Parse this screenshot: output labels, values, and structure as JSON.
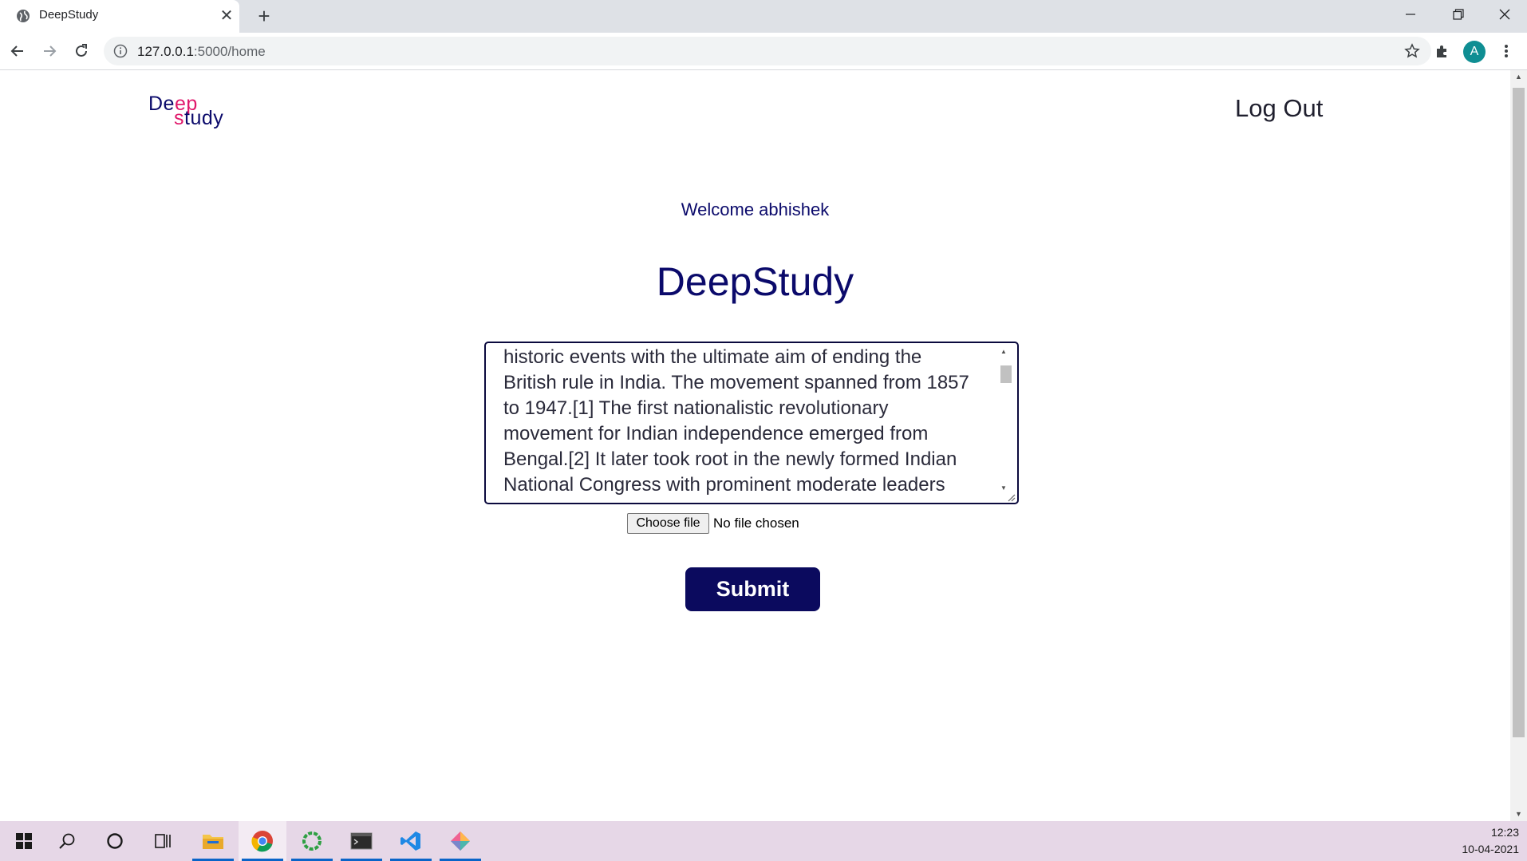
{
  "browser": {
    "tab_title": "DeepStudy",
    "url_host": "127.0.0.1",
    "url_path": ":5000/home",
    "profile_initial": "A"
  },
  "page": {
    "logo_line1_a": "De",
    "logo_line1_b": "ep",
    "logo_line2_a": "s",
    "logo_line2_b": "tudy",
    "logout_label": "Log Out",
    "welcome_text": "Welcome abhishek",
    "title": "DeepStudy",
    "textarea_value": "historic events with the ultimate aim of ending the\nBritish rule in India. The movement spanned from 1857\nto 1947.[1] The first nationalistic revolutionary\nmovement for Indian independence emerged from\nBengal.[2] It later took root in the newly formed Indian\nNational Congress with prominent moderate leaders",
    "file_button_label": "Choose file",
    "file_status": "No file chosen",
    "submit_label": "Submit"
  },
  "taskbar": {
    "time": "12:23",
    "date": "10-04-2021"
  },
  "colors": {
    "brand_navy": "#0b0a5e",
    "logo_pink": "#e0186b",
    "avatar_teal": "#0f8e93"
  }
}
